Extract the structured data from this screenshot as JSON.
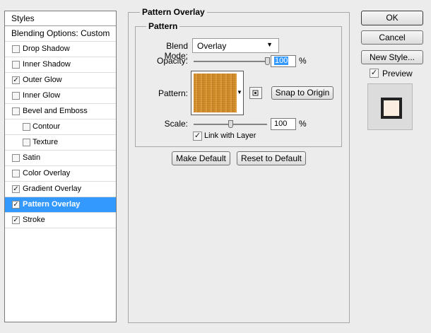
{
  "sidebar": {
    "title": "Styles",
    "items": [
      {
        "label": "Blending Options: Custom",
        "type": "header"
      },
      {
        "label": "Drop Shadow",
        "checked": false
      },
      {
        "label": "Inner Shadow",
        "checked": false
      },
      {
        "label": "Outer Glow",
        "checked": true
      },
      {
        "label": "Inner Glow",
        "checked": false
      },
      {
        "label": "Bevel and Emboss",
        "checked": false
      },
      {
        "label": "Contour",
        "checked": false,
        "sub": true
      },
      {
        "label": "Texture",
        "checked": false,
        "sub": true
      },
      {
        "label": "Satin",
        "checked": false
      },
      {
        "label": "Color Overlay",
        "checked": false
      },
      {
        "label": "Gradient Overlay",
        "checked": true
      },
      {
        "label": "Pattern Overlay",
        "checked": true,
        "selected": true
      },
      {
        "label": "Stroke",
        "checked": true
      }
    ]
  },
  "main": {
    "title": "Pattern Overlay",
    "group_title": "Pattern",
    "blend_mode_label": "Blend Mode:",
    "blend_mode_value": "Overlay",
    "opacity_label": "Opacity:",
    "opacity_value": "100",
    "opacity_percent": 1.0,
    "percent_sign": "%",
    "pattern_label": "Pattern:",
    "snap_button": "Snap to Origin",
    "scale_label": "Scale:",
    "scale_value": "100",
    "scale_fraction": 0.5,
    "link_label": "Link with Layer",
    "link_checked": true,
    "make_default": "Make Default",
    "reset_default": "Reset to Default"
  },
  "actions": {
    "ok": "OK",
    "cancel": "Cancel",
    "new_style": "New Style...",
    "preview_label": "Preview",
    "preview_checked": true
  },
  "colors": {
    "selection": "#3399ff",
    "pattern_base": "#d08a28",
    "preview_fill": "#fbeee0",
    "preview_border": "#222222"
  }
}
